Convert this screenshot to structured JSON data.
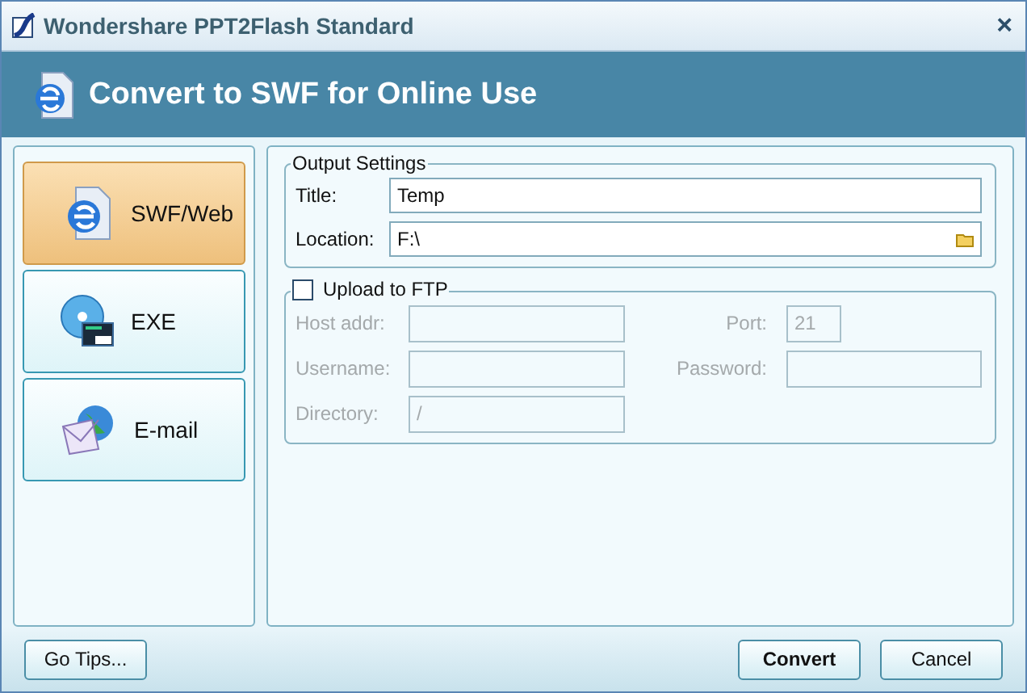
{
  "window": {
    "title": "Wondershare PPT2Flash Standard",
    "close": "×"
  },
  "header": {
    "title": "Convert to SWF for Online Use"
  },
  "modes": [
    {
      "label": "SWF/Web",
      "kind": "web",
      "selected": true
    },
    {
      "label": "EXE",
      "kind": "exe",
      "selected": false
    },
    {
      "label": "E-mail",
      "kind": "mail",
      "selected": false
    }
  ],
  "output_settings": {
    "legend": "Output Settings",
    "title_label": "Title:",
    "title_value": "Temp",
    "location_label": "Location:",
    "location_value": "F:\\"
  },
  "ftp": {
    "label": "Upload to FTP",
    "checked": false,
    "disabled": true,
    "host_label": "Host addr:",
    "port_label": "Port:",
    "port_value": "21",
    "username_label": "Username:",
    "password_label": "Password:",
    "directory_label": "Directory:",
    "directory_value": "/"
  },
  "buttons": {
    "tips": "Go Tips...",
    "convert": "Convert",
    "cancel": "Cancel"
  }
}
